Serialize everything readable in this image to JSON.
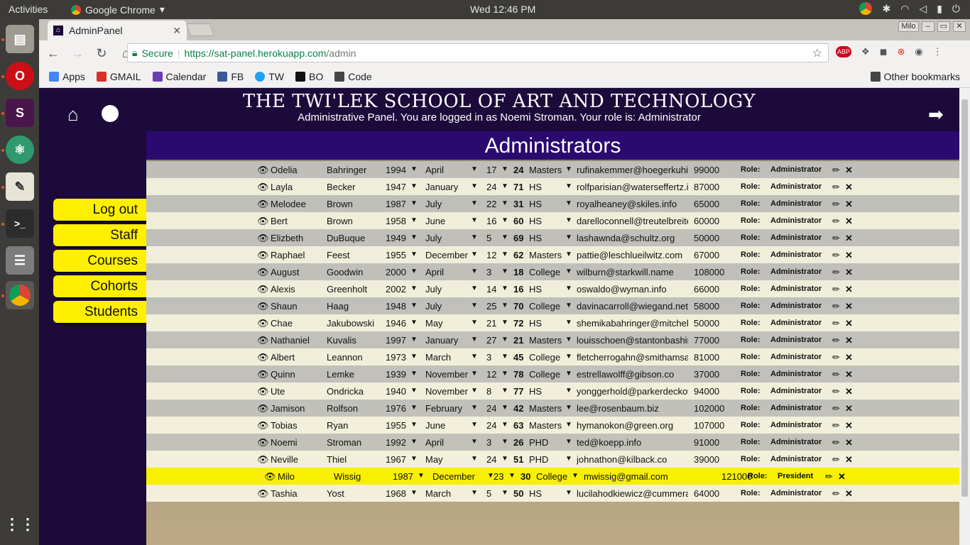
{
  "os": {
    "activities": "Activities",
    "app_name": "Google Chrome",
    "clock": "Wed 12:46 PM"
  },
  "browser": {
    "tab_title": "AdminPanel",
    "user": "Milo",
    "secure_label": "Secure",
    "url_scheme_host": "https://sat-panel.herokuapp.com",
    "url_path": "/admin",
    "bookmarks": [
      {
        "label": "Apps",
        "color": "#4285f4"
      },
      {
        "label": "GMAIL",
        "color": "#d93025"
      },
      {
        "label": "Calendar",
        "color": "#6a3fb5"
      },
      {
        "label": "FB",
        "color": "#3b5998"
      },
      {
        "label": "TW",
        "color": "#1da1f2"
      },
      {
        "label": "BO",
        "color": "#111111"
      },
      {
        "label": "Code",
        "color": "#444444"
      }
    ],
    "other_bookmarks": "Other bookmarks"
  },
  "header": {
    "school_name": "THE TWI'LEK SCHOOL OF ART AND TECHNOLOGY",
    "subtitle": "Administrative Panel. You are logged in as Noemi Stroman. Your role is: Administrator"
  },
  "sidebar": {
    "items": [
      {
        "label": "Log out"
      },
      {
        "label": "Staff"
      },
      {
        "label": "Courses"
      },
      {
        "label": "Cohorts"
      },
      {
        "label": "Students"
      }
    ]
  },
  "panel": {
    "heading": "Administrators",
    "role_label": "Role:"
  },
  "admins": [
    {
      "first": "Odelia",
      "last": "Bahringer",
      "year": "1994",
      "month": "April",
      "day": "17",
      "age": "24",
      "edu": "Masters",
      "email": "rufinakemmer@hoegerkuhic.biz",
      "salary": "99000",
      "role": "Administrator"
    },
    {
      "first": "Layla",
      "last": "Becker",
      "year": "1947",
      "month": "January",
      "day": "24",
      "age": "71",
      "edu": "HS",
      "email": "rolfparisian@waterseffertz.info",
      "salary": "87000",
      "role": "Administrator"
    },
    {
      "first": "Melodee",
      "last": "Brown",
      "year": "1987",
      "month": "July",
      "day": "22",
      "age": "31",
      "edu": "HS",
      "email": "royalheaney@skiles.info",
      "salary": "65000",
      "role": "Administrator"
    },
    {
      "first": "Bert",
      "last": "Brown",
      "year": "1958",
      "month": "June",
      "day": "16",
      "age": "60",
      "edu": "HS",
      "email": "darelloconnell@treutelbreitenberg.com",
      "salary": "60000",
      "role": "Administrator"
    },
    {
      "first": "Elizbeth",
      "last": "DuBuque",
      "year": "1949",
      "month": "July",
      "day": "5",
      "age": "69",
      "edu": "HS",
      "email": "lashawnda@schultz.org",
      "salary": "50000",
      "role": "Administrator"
    },
    {
      "first": "Raphael",
      "last": "Feest",
      "year": "1955",
      "month": "December",
      "day": "12",
      "age": "62",
      "edu": "Masters",
      "email": "pattie@leschlueilwitz.com",
      "salary": "67000",
      "role": "Administrator"
    },
    {
      "first": "August",
      "last": "Goodwin",
      "year": "2000",
      "month": "April",
      "day": "3",
      "age": "18",
      "edu": "College",
      "email": "wilburn@starkwill.name",
      "salary": "108000",
      "role": "Administrator"
    },
    {
      "first": "Alexis",
      "last": "Greenholt",
      "year": "2002",
      "month": "July",
      "day": "14",
      "age": "16",
      "edu": "HS",
      "email": "oswaldo@wyman.info",
      "salary": "66000",
      "role": "Administrator"
    },
    {
      "first": "Shaun",
      "last": "Haag",
      "year": "1948",
      "month": "July",
      "day": "25",
      "age": "70",
      "edu": "College",
      "email": "davinacarroll@wiegand.net",
      "salary": "58000",
      "role": "Administrator"
    },
    {
      "first": "Chae",
      "last": "Jakubowski",
      "year": "1946",
      "month": "May",
      "day": "21",
      "age": "72",
      "edu": "HS",
      "email": "shemikabahringer@mitchellcarter.com",
      "salary": "50000",
      "role": "Administrator"
    },
    {
      "first": "Nathaniel",
      "last": "Kuvalis",
      "year": "1997",
      "month": "January",
      "day": "27",
      "age": "21",
      "edu": "Masters",
      "email": "louisschoen@stantonbashirian.com",
      "salary": "77000",
      "role": "Administrator"
    },
    {
      "first": "Albert",
      "last": "Leannon",
      "year": "1973",
      "month": "March",
      "day": "3",
      "age": "45",
      "edu": "College",
      "email": "fletcherrogahn@smithamsawayn.com",
      "salary": "81000",
      "role": "Administrator"
    },
    {
      "first": "Quinn",
      "last": "Lemke",
      "year": "1939",
      "month": "November",
      "day": "12",
      "age": "78",
      "edu": "College",
      "email": "estrellawolff@gibson.co",
      "salary": "37000",
      "role": "Administrator"
    },
    {
      "first": "Ute",
      "last": "Ondricka",
      "year": "1940",
      "month": "November",
      "day": "8",
      "age": "77",
      "edu": "HS",
      "email": "yonggerhold@parkerdeckow.info",
      "salary": "94000",
      "role": "Administrator"
    },
    {
      "first": "Jamison",
      "last": "Rolfson",
      "year": "1976",
      "month": "February",
      "day": "24",
      "age": "42",
      "edu": "Masters",
      "email": "lee@rosenbaum.biz",
      "salary": "102000",
      "role": "Administrator"
    },
    {
      "first": "Tobias",
      "last": "Ryan",
      "year": "1955",
      "month": "June",
      "day": "24",
      "age": "63",
      "edu": "Masters",
      "email": "hymanokon@green.org",
      "salary": "107000",
      "role": "Administrator"
    },
    {
      "first": "Noemi",
      "last": "Stroman",
      "year": "1992",
      "month": "April",
      "day": "3",
      "age": "26",
      "edu": "PHD",
      "email": "ted@koepp.info",
      "salary": "91000",
      "role": "Administrator"
    },
    {
      "first": "Neville",
      "last": "Thiel",
      "year": "1967",
      "month": "May",
      "day": "24",
      "age": "51",
      "edu": "PHD",
      "email": "johnathon@kilback.co",
      "salary": "39000",
      "role": "Administrator"
    },
    {
      "first": "Milo",
      "last": "Wissig",
      "year": "1987",
      "month": "December",
      "day": "23",
      "age": "30",
      "edu": "College",
      "email": "mwissig@gmail.com",
      "salary": "121000",
      "role": "President",
      "highlight": true
    },
    {
      "first": "Tashia",
      "last": "Yost",
      "year": "1968",
      "month": "March",
      "day": "5",
      "age": "50",
      "edu": "HS",
      "email": "lucilahodkiewicz@cummerata.com",
      "salary": "64000",
      "role": "Administrator"
    }
  ]
}
